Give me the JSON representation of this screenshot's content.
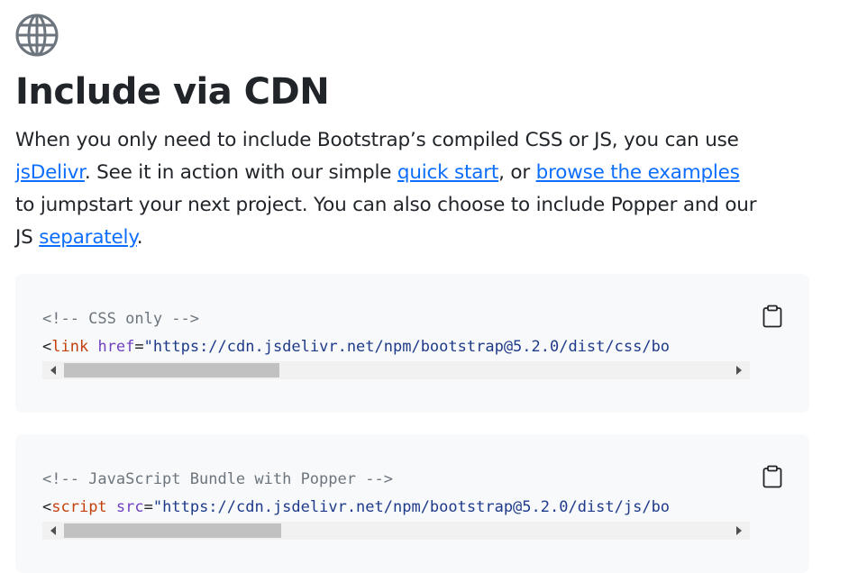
{
  "heading": {
    "icon": "globe-icon",
    "title": "Include via CDN"
  },
  "lead": {
    "part1": "When you only need to include Bootstrap’s compiled CSS or JS, you can use ",
    "link_jsdelivr": "jsDelivr",
    "part2": ". See it in action with our simple ",
    "link_quick_start": "quick start",
    "part3": ", or ",
    "link_browse_examples": "browse the examples",
    "part4": " to jumpstart your next project. You can also choose to include Popper and our JS ",
    "link_separately": "separately",
    "part5": "."
  },
  "code_blocks": [
    {
      "comment": "<!-- CSS only -->",
      "open_bracket": "<",
      "tag": "link",
      "attr": "href",
      "equals": "=",
      "value": "\"https://cdn.jsdelivr.net/npm/bootstrap@5.2.0/dist/css/bo",
      "copy_icon": "clipboard-icon"
    },
    {
      "comment": "<!-- JavaScript Bundle with Popper -->",
      "open_bracket": "<",
      "tag": "script",
      "attr": "src",
      "equals": "=",
      "value": "\"https://cdn.jsdelivr.net/npm/bootstrap@5.2.0/dist/js/bo",
      "copy_icon": "clipboard-icon"
    }
  ],
  "colors": {
    "link": "#0d6efd",
    "code_bg": "#f8f9fa",
    "tag": "#c2410c",
    "attr": "#6f42c1",
    "string": "#1e3a8a",
    "comment": "#6c757d"
  }
}
